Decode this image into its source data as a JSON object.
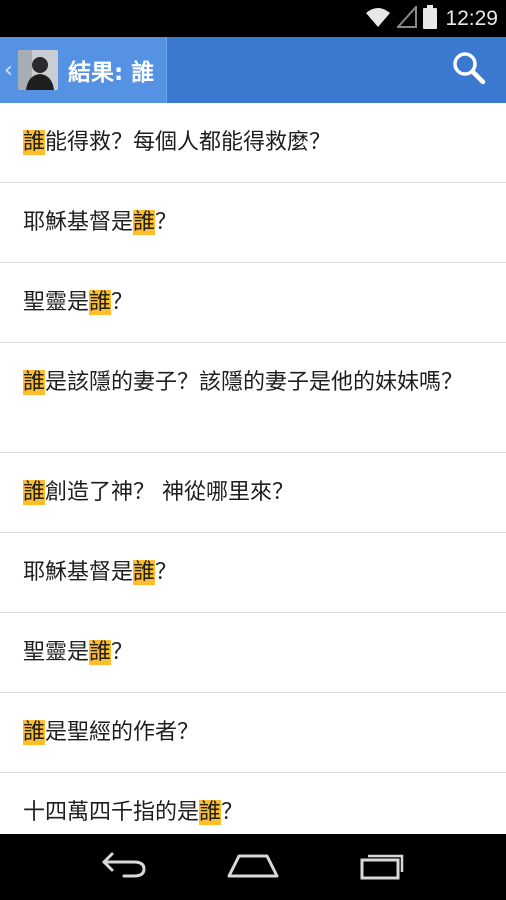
{
  "status_bar": {
    "time": "12:29",
    "icons": [
      "wifi-icon",
      "cell-signal-icon",
      "battery-icon"
    ]
  },
  "action_bar": {
    "up_caret": "‹",
    "title": "結果: 誰",
    "avatar_icon": "profile-avatar",
    "search_icon": "search-icon",
    "color": "#3b79d1"
  },
  "highlight_color": "#fdbd2c",
  "results": [
    {
      "before": "",
      "match": "誰",
      "after": "能得救？每個人都能得救麼？"
    },
    {
      "before": "耶穌基督是",
      "match": "誰",
      "after": "？"
    },
    {
      "before": "聖靈是",
      "match": "誰",
      "after": "？"
    },
    {
      "before": "",
      "match": "誰",
      "after": "是該隱的妻子？該隱的妻子是他的妹妹嗎？"
    },
    {
      "before": "",
      "match": "誰",
      "after": "創造了神？ 神從哪里來？"
    },
    {
      "before": "耶穌基督是",
      "match": "誰",
      "after": "？"
    },
    {
      "before": "聖靈是",
      "match": "誰",
      "after": "？"
    },
    {
      "before": "",
      "match": "誰",
      "after": "是聖經的作者？"
    },
    {
      "before": "十四萬四千指的是",
      "match": "誰",
      "after": "？"
    }
  ],
  "nav_bar": {
    "icons": [
      "back-icon",
      "home-icon",
      "recent-apps-icon"
    ]
  }
}
